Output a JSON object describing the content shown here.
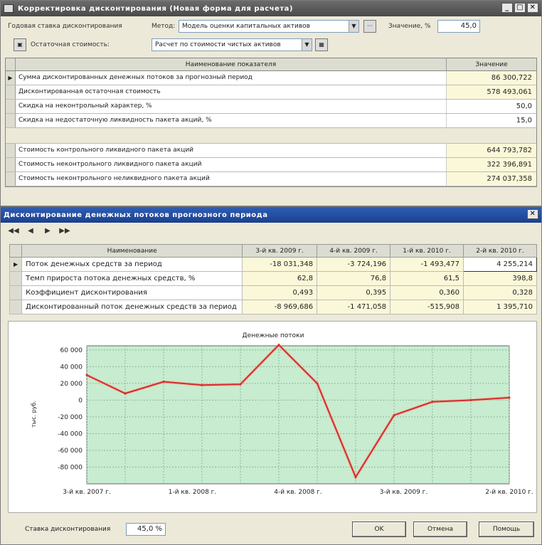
{
  "win1": {
    "title": "Корректировка дисконтирования (Новая форма для расчета)",
    "rate_label": "Годовая ставка дисконтирования",
    "method_label": "Метод:",
    "method_value": "Модель оценки капитальных активов",
    "value_label": "Значение, %",
    "value": "45,0",
    "residual_label": "Остаточная стоимость:",
    "residual_value": "Расчет по стоимости чистых активов",
    "grid_header_name": "Наименование показателя",
    "grid_header_value": "Значение",
    "rows": [
      {
        "name": "Сумма дисконтированных денежных потоков за прогнозный период",
        "value": "86 300,722"
      },
      {
        "name": "Дисконтированная остаточная стоимость",
        "value": "578 493,061"
      },
      {
        "name": "Скидка на неконтрольный характер, %",
        "value": "50,0"
      },
      {
        "name": "Скидка на недостаточную ликвидность пакета акций, %",
        "value": "15,0"
      }
    ],
    "rows2": [
      {
        "name": "Стоимость контрольного ликвидного пакета акций",
        "value": "644 793,782"
      },
      {
        "name": "Стоимость неконтрольного ликвидного пакета акций",
        "value": "322 396,891"
      },
      {
        "name": "Стоимость неконтрольного неликвидного пакета акций",
        "value": "274 037,358"
      }
    ]
  },
  "win2": {
    "title": "Дисконтирование денежных потоков прогнозного периода",
    "col_name": "Наименование",
    "columns": [
      "3-й кв. 2009 г.",
      "4-й кв. 2009 г.",
      "1-й кв. 2010 г.",
      "2-й кв. 2010 г."
    ],
    "rows": [
      {
        "name": "Поток денежных средств за период",
        "values": [
          "-18 031,348",
          "-3 724,196",
          "-1 493,477",
          "4 255,214"
        ]
      },
      {
        "name": "Темп прироста потока денежных средств, %",
        "values": [
          "62,8",
          "76,8",
          "61,5",
          "398,8"
        ]
      },
      {
        "name": "Коэффициент дисконтирования",
        "values": [
          "0,493",
          "0,395",
          "0,360",
          "0,328"
        ]
      },
      {
        "name": "Дисконтированный поток денежных средств за период",
        "values": [
          "-8 969,686",
          "-1 471,058",
          "-515,908",
          "1 395,710"
        ]
      }
    ],
    "bottom_label": "Ставка дисконтирования",
    "bottom_value": "45,0 %",
    "ok": "OK",
    "cancel": "Отмена",
    "help": "Помощь"
  },
  "chart_data": {
    "type": "line",
    "title": "Денежные потоки",
    "ylabel": "тыс. руб.",
    "xlabel": "",
    "ylim": [
      -100000,
      65000
    ],
    "yticks": [
      60000,
      40000,
      20000,
      0,
      -20000,
      -40000,
      -60000,
      -80000
    ],
    "x_tick_labels": [
      "3-й кв. 2007 г.",
      "1-й кв. 2008 г.",
      "4-й кв. 2008 г.",
      "3-й кв. 2009 г.",
      "2-й кв. 2010 г."
    ],
    "x": [
      0,
      1,
      2,
      3,
      4,
      5,
      6,
      7,
      8,
      9,
      10,
      11
    ],
    "values": [
      30000,
      8000,
      22000,
      18000,
      19000,
      66000,
      20000,
      -92000,
      -18000,
      -2000,
      0,
      3000
    ],
    "series_color": "#d62b2b",
    "plot_bg": "#c8ecd0",
    "grid": true
  }
}
